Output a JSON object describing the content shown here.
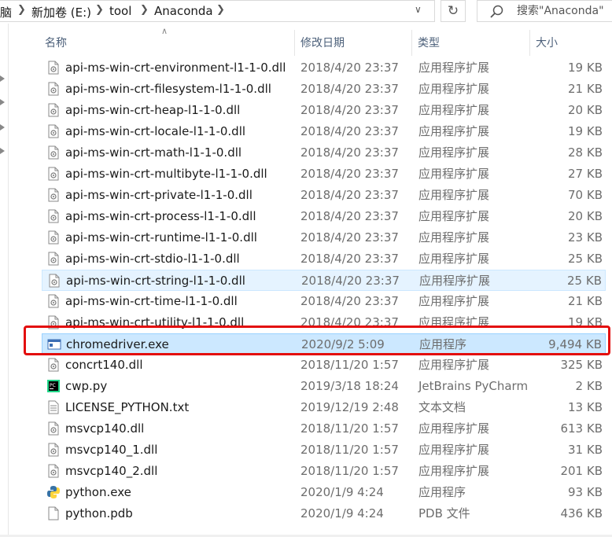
{
  "address_bar": {
    "crumbs": [
      "脑",
      "新加卷 (E:)",
      "tool",
      "Anaconda"
    ]
  },
  "search": {
    "placeholder": "搜索\"Anaconda\""
  },
  "columns": {
    "name": "名称",
    "date": "修改日期",
    "type": "类型",
    "size": "大小"
  },
  "files": [
    {
      "name": "api-ms-win-crt-environment-l1-1-0.dll",
      "date": "2018/4/20 23:37",
      "type": "应用程序扩展",
      "size": "19 KB",
      "icon": "dll-icon"
    },
    {
      "name": "api-ms-win-crt-filesystem-l1-1-0.dll",
      "date": "2018/4/20 23:37",
      "type": "应用程序扩展",
      "size": "21 KB",
      "icon": "dll-icon"
    },
    {
      "name": "api-ms-win-crt-heap-l1-1-0.dll",
      "date": "2018/4/20 23:37",
      "type": "应用程序扩展",
      "size": "20 KB",
      "icon": "dll-icon"
    },
    {
      "name": "api-ms-win-crt-locale-l1-1-0.dll",
      "date": "2018/4/20 23:37",
      "type": "应用程序扩展",
      "size": "19 KB",
      "icon": "dll-icon"
    },
    {
      "name": "api-ms-win-crt-math-l1-1-0.dll",
      "date": "2018/4/20 23:37",
      "type": "应用程序扩展",
      "size": "28 KB",
      "icon": "dll-icon"
    },
    {
      "name": "api-ms-win-crt-multibyte-l1-1-0.dll",
      "date": "2018/4/20 23:37",
      "type": "应用程序扩展",
      "size": "27 KB",
      "icon": "dll-icon"
    },
    {
      "name": "api-ms-win-crt-private-l1-1-0.dll",
      "date": "2018/4/20 23:37",
      "type": "应用程序扩展",
      "size": "70 KB",
      "icon": "dll-icon"
    },
    {
      "name": "api-ms-win-crt-process-l1-1-0.dll",
      "date": "2018/4/20 23:37",
      "type": "应用程序扩展",
      "size": "20 KB",
      "icon": "dll-icon"
    },
    {
      "name": "api-ms-win-crt-runtime-l1-1-0.dll",
      "date": "2018/4/20 23:37",
      "type": "应用程序扩展",
      "size": "23 KB",
      "icon": "dll-icon"
    },
    {
      "name": "api-ms-win-crt-stdio-l1-1-0.dll",
      "date": "2018/4/20 23:37",
      "type": "应用程序扩展",
      "size": "25 KB",
      "icon": "dll-icon"
    },
    {
      "name": "api-ms-win-crt-string-l1-1-0.dll",
      "date": "2018/4/20 23:37",
      "type": "应用程序扩展",
      "size": "25 KB",
      "icon": "dll-icon",
      "state": "hover"
    },
    {
      "name": "api-ms-win-crt-time-l1-1-0.dll",
      "date": "2018/4/20 23:37",
      "type": "应用程序扩展",
      "size": "21 KB",
      "icon": "dll-icon"
    },
    {
      "name": "api-ms-win-crt-utility-l1-1-0.dll",
      "date": "2018/4/20 23:37",
      "type": "应用程序扩展",
      "size": "19 KB",
      "icon": "dll-icon"
    },
    {
      "name": "chromedriver.exe",
      "date": "2020/9/2 5:09",
      "type": "应用程序",
      "size": "9,494 KB",
      "icon": "exe-window-icon",
      "state": "selected"
    },
    {
      "name": "concrt140.dll",
      "date": "2018/11/20 1:57",
      "type": "应用程序扩展",
      "size": "325 KB",
      "icon": "dll-icon"
    },
    {
      "name": "cwp.py",
      "date": "2019/3/18 18:24",
      "type": "JetBrains PyCharm",
      "size": "2 KB",
      "icon": "pycharm-icon"
    },
    {
      "name": "LICENSE_PYTHON.txt",
      "date": "2019/12/19 2:48",
      "type": "文本文档",
      "size": "13 KB",
      "icon": "text-file-icon"
    },
    {
      "name": "msvcp140.dll",
      "date": "2018/11/20 1:57",
      "type": "应用程序扩展",
      "size": "613 KB",
      "icon": "dll-icon"
    },
    {
      "name": "msvcp140_1.dll",
      "date": "2018/11/20 1:57",
      "type": "应用程序扩展",
      "size": "31 KB",
      "icon": "dll-icon"
    },
    {
      "name": "msvcp140_2.dll",
      "date": "2018/11/20 1:57",
      "type": "应用程序扩展",
      "size": "201 KB",
      "icon": "dll-icon"
    },
    {
      "name": "python.exe",
      "date": "2020/1/9 4:24",
      "type": "应用程序",
      "size": "93 KB",
      "icon": "python-icon"
    },
    {
      "name": "python.pdb",
      "date": "2020/1/9 4:24",
      "type": "PDB 文件",
      "size": "436 KB",
      "icon": "blank-file-icon"
    }
  ],
  "colors": {
    "selection_bg": "#cce8ff",
    "selection_border": "#99d1ff",
    "hover_bg": "#e5f3ff",
    "highlight_box": "#e30e0e",
    "header_text": "#4c607a"
  }
}
